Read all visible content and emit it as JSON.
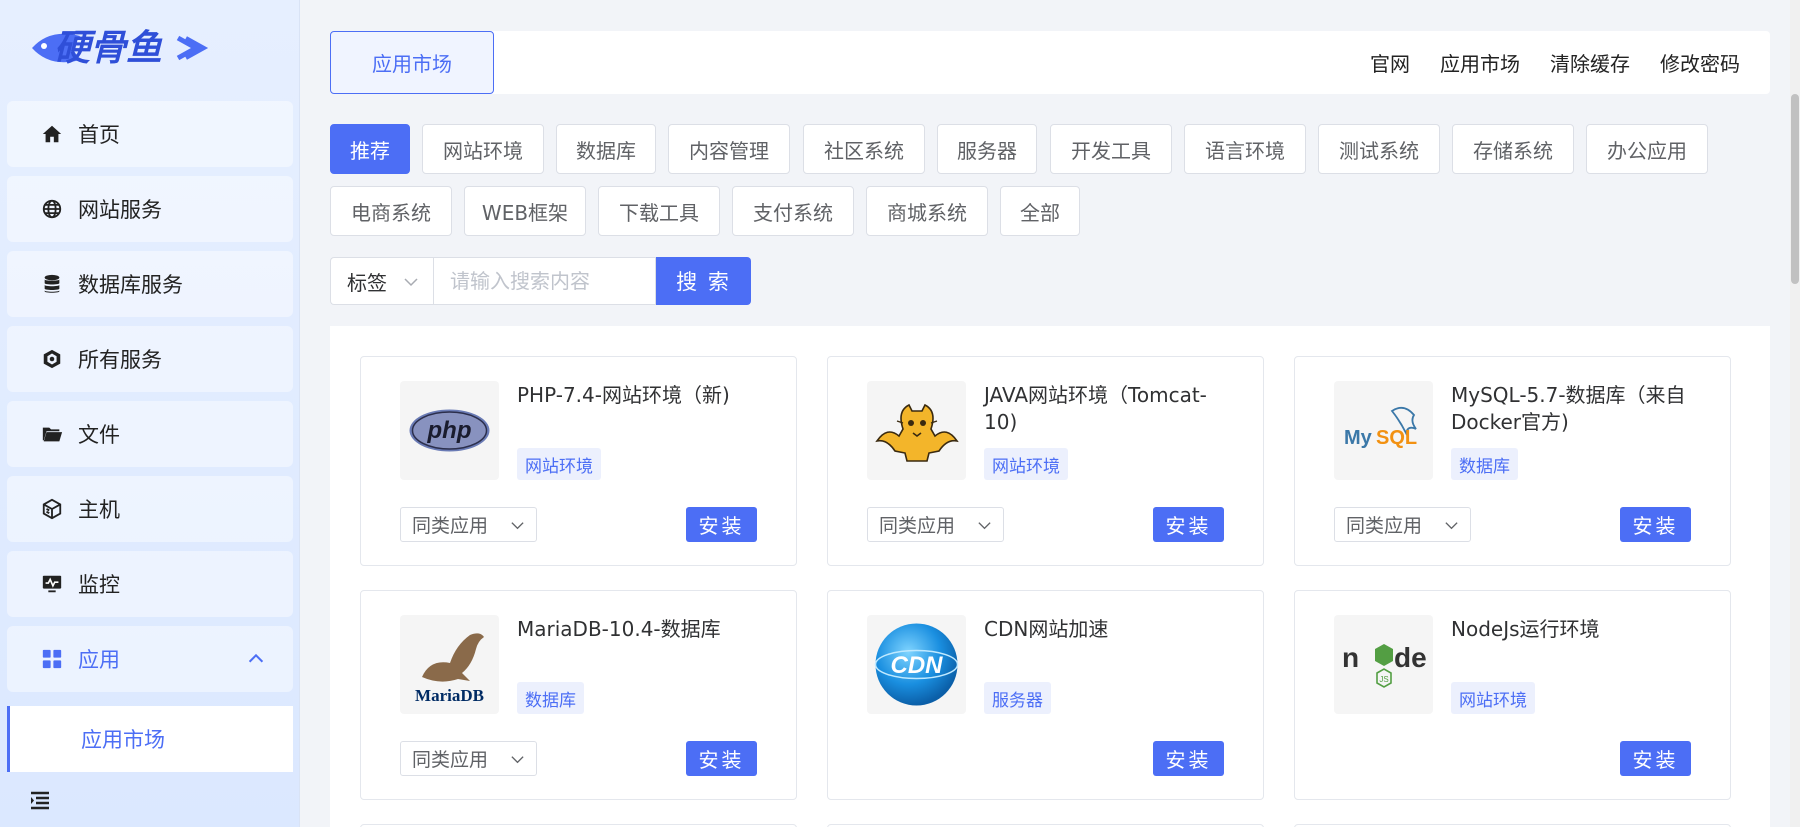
{
  "brand": {
    "logo_text": "硬骨鱼"
  },
  "sidebar": {
    "items": [
      {
        "label": "首页",
        "icon": "home-icon"
      },
      {
        "label": "网站服务",
        "icon": "globe-icon"
      },
      {
        "label": "数据库服务",
        "icon": "database-icon"
      },
      {
        "label": "所有服务",
        "icon": "cube-icon"
      },
      {
        "label": "文件",
        "icon": "folder-icon"
      },
      {
        "label": "主机",
        "icon": "server-icon"
      },
      {
        "label": "监控",
        "icon": "monitor-icon"
      },
      {
        "label": "应用",
        "icon": "apps-icon",
        "expanded": true
      }
    ],
    "sub_items": [
      {
        "label": "应用市场",
        "selected": true
      }
    ],
    "collapse_icon": "menu-collapse-icon"
  },
  "topbar": {
    "active_tab": "应用市场",
    "links": [
      "官网",
      "应用市场",
      "清除缓存",
      "修改密码"
    ]
  },
  "categories": {
    "selected": "推荐",
    "items": [
      "推荐",
      "网站环境",
      "数据库",
      "内容管理",
      "社区系统",
      "服务器",
      "开发工具",
      "语言环境",
      "测试系统",
      "存储系统",
      "办公应用",
      "电商系统",
      "WEB框架",
      "下载工具",
      "支付系统",
      "商城系统",
      "全部"
    ]
  },
  "search": {
    "tag_label": "标签",
    "placeholder": "请输入搜索内容",
    "button_label": "搜 索"
  },
  "apps": [
    {
      "name": "PHP-7.4-网站环境（新)",
      "badge": "网站环境",
      "logo": "php-logo",
      "similar": "同类应用",
      "install": "安装"
    },
    {
      "name": "JAVA网站环境（Tomcat-10)",
      "badge": "网站环境",
      "logo": "tomcat-logo",
      "similar": "同类应用",
      "install": "安装"
    },
    {
      "name": "MySQL-5.7-数据库（来自Docker官方)",
      "badge": "数据库",
      "logo": "mysql-logo",
      "similar": "同类应用",
      "install": "安装"
    },
    {
      "name": "MariaDB-10.4-数据库",
      "badge": "数据库",
      "logo": "mariadb-logo",
      "similar": "同类应用",
      "install": "安装"
    },
    {
      "name": "CDN网站加速",
      "badge": "服务器",
      "logo": "cdn-logo",
      "install": "安装"
    },
    {
      "name": "NodeJs运行环境",
      "badge": "网站环境",
      "logo": "nodejs-logo",
      "install": "安装"
    }
  ],
  "colors": {
    "accent": "#4c6ef5",
    "sidebar_bg": "#e6efff"
  }
}
